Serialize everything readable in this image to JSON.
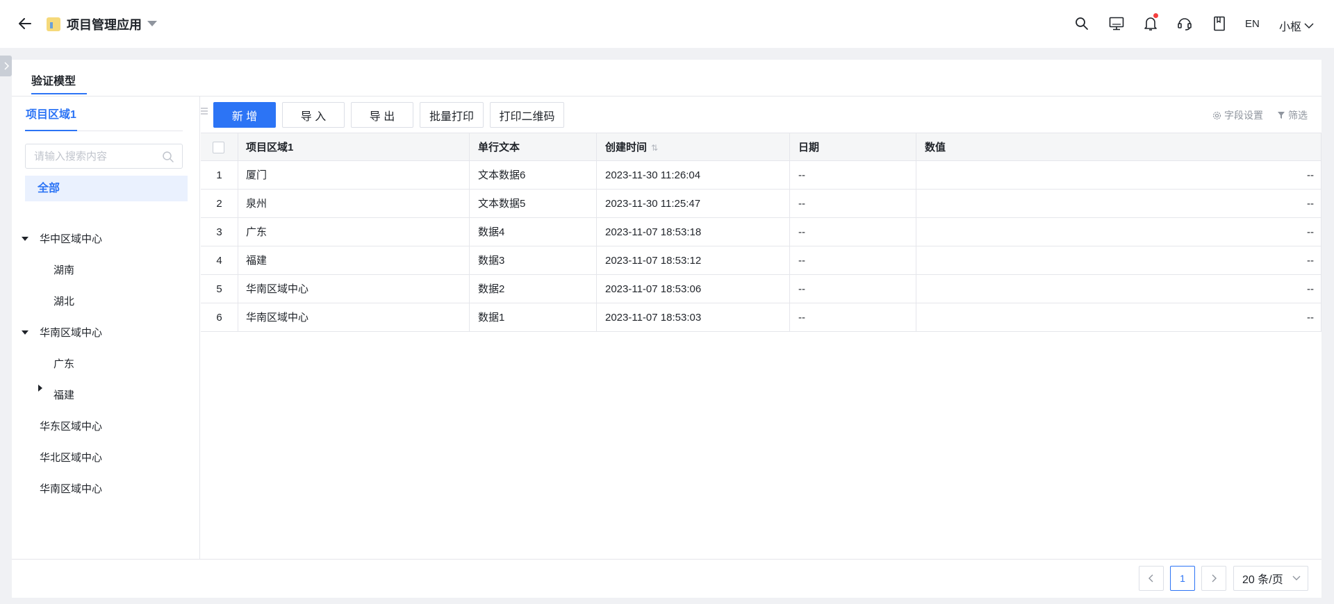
{
  "header": {
    "app_title": "项目管理应用",
    "icons": [
      "back-arrow-icon",
      "app-logo-icon",
      "dropdown-caret-icon",
      "search-icon",
      "monitor-icon",
      "bell-icon",
      "headset-icon",
      "book-icon"
    ],
    "language": "EN",
    "user_name": "小枢"
  },
  "page": {
    "title_tab": "验证模型"
  },
  "left_panel": {
    "tab": "项目区域1",
    "search_placeholder": "请输入搜索内容",
    "all_label": "全部",
    "tree": [
      {
        "label": "华中区域中心",
        "expanded": true
      },
      {
        "label": "湖南"
      },
      {
        "label": "湖北"
      },
      {
        "label": "华南区域中心",
        "expanded": true
      },
      {
        "label": "广东"
      },
      {
        "label": "福建",
        "expanded": false
      },
      {
        "label": "华东区域中心"
      },
      {
        "label": "华北区域中心"
      },
      {
        "label": "华南区域中心"
      }
    ]
  },
  "toolbar": {
    "add_label": "新 增",
    "import_label": "导 入",
    "export_label": "导 出",
    "batch_print_label": "批量打印",
    "print_qr_label": "打印二维码",
    "field_settings_label": "字段设置",
    "filter_label": "筛选"
  },
  "table": {
    "columns": [
      "项目区域1",
      "单行文本",
      "创建时间",
      "日期",
      "数值"
    ],
    "rows": [
      {
        "index": "1",
        "area": "厦门",
        "text": "文本数据6",
        "created": "2023-11-30 11:26:04",
        "date": "--",
        "value": "--"
      },
      {
        "index": "2",
        "area": "泉州",
        "text": "文本数据5",
        "created": "2023-11-30 11:25:47",
        "date": "--",
        "value": "--"
      },
      {
        "index": "3",
        "area": "广东",
        "text": "数据4",
        "created": "2023-11-07 18:53:18",
        "date": "--",
        "value": "--"
      },
      {
        "index": "4",
        "area": "福建",
        "text": "数据3",
        "created": "2023-11-07 18:53:12",
        "date": "--",
        "value": "--"
      },
      {
        "index": "5",
        "area": "华南区域中心",
        "text": "数据2",
        "created": "2023-11-07 18:53:06",
        "date": "--",
        "value": "--"
      },
      {
        "index": "6",
        "area": "华南区域中心",
        "text": "数据1",
        "created": "2023-11-07 18:53:03",
        "date": "--",
        "value": "--"
      }
    ]
  },
  "pagination": {
    "current_page": "1",
    "page_size": "20 条/页"
  },
  "colors": {
    "primary": "#2c74f5",
    "notification_dot": "#f53f3f"
  }
}
